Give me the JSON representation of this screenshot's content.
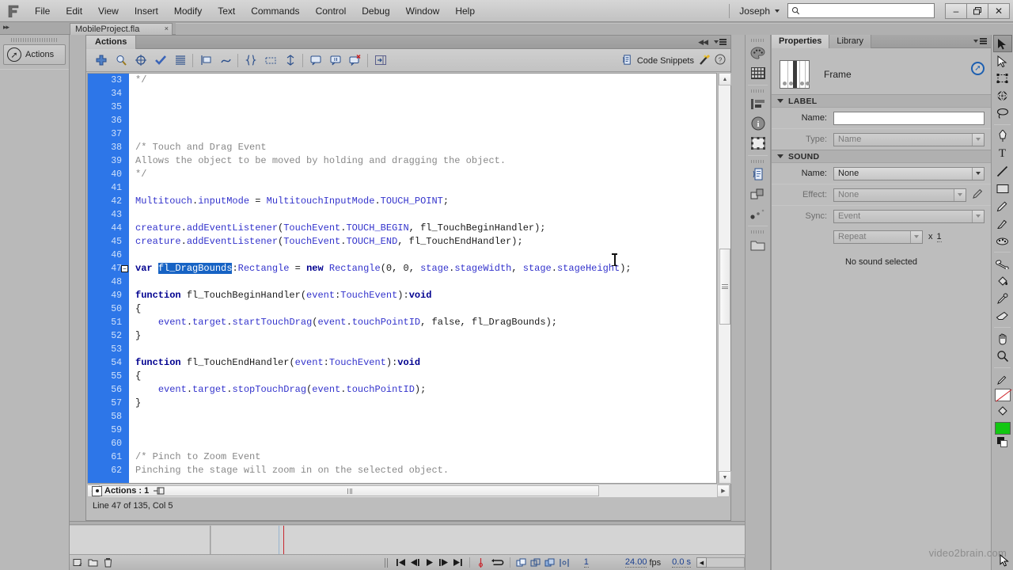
{
  "app": {
    "title": "Adobe Flash Professional",
    "logo": "fl-logo-icon"
  },
  "menubar": {
    "items": [
      "File",
      "Edit",
      "View",
      "Insert",
      "Modify",
      "Text",
      "Commands",
      "Control",
      "Debug",
      "Window",
      "Help"
    ],
    "user": "Joseph",
    "search": {
      "value": "",
      "placeholder": "",
      "icon": "search-icon"
    },
    "window_controls": {
      "minimize": "–",
      "restore": "❐",
      "close": "✕"
    }
  },
  "document_tab": {
    "label": "MobileProject.fla",
    "close": "×"
  },
  "left_dock": {
    "actions_chip_label": "Actions",
    "icon": "actions-arrow-icon"
  },
  "actions_panel": {
    "tab_label": "Actions",
    "titlebar": {
      "collapse": "◀◀",
      "menu": "panel-menu-icon"
    },
    "toolbar_icons": [
      "add-script-icon",
      "find-icon",
      "target-insert-icon",
      "check-syntax-icon",
      "auto-format-icon",
      "show-code-hint-icon",
      "debug-options-icon",
      "collapse-between-braces-icon",
      "collapse-selection-icon",
      "expand-all-icon",
      "apply-block-comment-icon",
      "apply-line-comment-icon",
      "remove-comment-icon",
      "show-hide-toolbox-icon"
    ],
    "code_snippets_label": "Code Snippets",
    "code_snippets_icon": "code-snippets-icon",
    "wand_icon": "magic-wand-icon",
    "help_icon": "help-icon",
    "breadcrumb": {
      "label": "Actions : 1",
      "pin_icon": "pin-script-icon"
    },
    "status": "Line 47 of 135, Col 5",
    "first_line_number": 33,
    "lines": [
      {
        "n": 33,
        "text": "*/",
        "style": "comment"
      },
      {
        "n": 34,
        "text": ""
      },
      {
        "n": 35,
        "text": ""
      },
      {
        "n": 36,
        "text": ""
      },
      {
        "n": 37,
        "text": ""
      },
      {
        "n": 38,
        "text": "/* Touch and Drag Event",
        "style": "comment"
      },
      {
        "n": 39,
        "text": "Allows the object to be moved by holding and dragging the object.",
        "style": "comment"
      },
      {
        "n": 40,
        "text": "*/",
        "style": "comment"
      },
      {
        "n": 41,
        "text": ""
      },
      {
        "n": 42,
        "text": "Multitouch.inputMode = MultitouchInputMode.TOUCH_POINT;",
        "style": "code"
      },
      {
        "n": 43,
        "text": ""
      },
      {
        "n": 44,
        "text": "creature.addEventListener(TouchEvent.TOUCH_BEGIN, fl_TouchBeginHandler);",
        "style": "code"
      },
      {
        "n": 45,
        "text": "creature.addEventListener(TouchEvent.TOUCH_END, fl_TouchEndHandler);",
        "style": "code"
      },
      {
        "n": 46,
        "text": ""
      },
      {
        "n": 47,
        "text": "var fl_DragBounds:Rectangle = new Rectangle(0, 0, stage.stageWidth, stage.stageHeight);",
        "style": "code",
        "fold": true,
        "selection": "fl_DragBounds"
      },
      {
        "n": 48,
        "text": ""
      },
      {
        "n": 49,
        "text": "function fl_TouchBeginHandler(event:TouchEvent):void",
        "style": "code"
      },
      {
        "n": 50,
        "text": "{",
        "style": "code"
      },
      {
        "n": 51,
        "text": "    event.target.startTouchDrag(event.touchPointID, false, fl_DragBounds);",
        "style": "code"
      },
      {
        "n": 52,
        "text": "}",
        "style": "code"
      },
      {
        "n": 53,
        "text": ""
      },
      {
        "n": 54,
        "text": "function fl_TouchEndHandler(event:TouchEvent):void",
        "style": "code"
      },
      {
        "n": 55,
        "text": "{",
        "style": "code"
      },
      {
        "n": 56,
        "text": "    event.target.stopTouchDrag(event.touchPointID);",
        "style": "code"
      },
      {
        "n": 57,
        "text": "}",
        "style": "code"
      },
      {
        "n": 58,
        "text": ""
      },
      {
        "n": 59,
        "text": ""
      },
      {
        "n": 60,
        "text": ""
      },
      {
        "n": 61,
        "text": "/* Pinch to Zoom Event",
        "style": "comment"
      },
      {
        "n": 62,
        "text": "Pinching the stage will zoom in on the selected object.",
        "style": "comment"
      }
    ]
  },
  "right_dock_icons": [
    "color-panel-icon",
    "swatches-panel-icon",
    "align-panel-icon",
    "info-panel-icon",
    "transform-panel-icon",
    "code-snippets-panel-icon",
    "components-panel-icon",
    "motion-presets-icon",
    "library-panel-icon"
  ],
  "properties": {
    "tabs": [
      {
        "label": "Properties",
        "active": true
      },
      {
        "label": "Library",
        "active": false
      }
    ],
    "menu_icon": "panel-menu-icon",
    "frame": {
      "label": "Frame",
      "thumb": "frame-thumbnail-icon",
      "badge": "edit-in-place-icon"
    },
    "sections": [
      {
        "title": "LABEL",
        "rows": [
          {
            "label": "Name:",
            "type": "input",
            "value": "",
            "disabled": false
          },
          {
            "label": "Type:",
            "type": "select",
            "value": "Name",
            "disabled": true
          }
        ]
      },
      {
        "title": "SOUND",
        "rows": [
          {
            "label": "Name:",
            "type": "select",
            "value": "None",
            "disabled": false
          },
          {
            "label": "Effect:",
            "type": "select",
            "value": "None",
            "disabled": true,
            "trailing_icon": "pencil-edit-icon"
          },
          {
            "label": "Sync:",
            "type": "select",
            "value": "Event",
            "disabled": true
          },
          {
            "label": "",
            "type": "select",
            "value": "Repeat",
            "disabled": true,
            "multiplier_label": "x",
            "multiplier_value": "1"
          }
        ],
        "footer": "No sound selected"
      }
    ]
  },
  "tools": {
    "items": [
      {
        "name": "selection-tool-icon",
        "glyph": "➤",
        "selected": true
      },
      {
        "name": "subselection-tool-icon",
        "glyph": "➤",
        "selected": false
      },
      {
        "name": "free-transform-tool-icon",
        "glyph": "❑",
        "selected": false
      },
      {
        "name": "3d-rotation-tool-icon",
        "glyph": "●",
        "selected": false
      },
      {
        "name": "lasso-tool-icon",
        "glyph": "◯",
        "selected": false
      },
      {
        "name": "pen-tool-icon",
        "glyph": "✒",
        "selected": false
      },
      {
        "name": "text-tool-icon",
        "glyph": "T",
        "selected": false
      },
      {
        "name": "line-tool-icon",
        "glyph": "╱",
        "selected": false
      },
      {
        "name": "rectangle-tool-icon",
        "glyph": "▭",
        "selected": false
      },
      {
        "name": "pencil-tool-icon",
        "glyph": "✎",
        "selected": false
      },
      {
        "name": "brush-tool-icon",
        "glyph": "✐",
        "selected": false
      },
      {
        "name": "deco-tool-icon",
        "glyph": "❁",
        "selected": false
      },
      {
        "name": "bone-tool-icon",
        "glyph": "☈",
        "selected": false
      },
      {
        "name": "paint-bucket-tool-icon",
        "glyph": "◢",
        "selected": false
      },
      {
        "name": "eyedropper-tool-icon",
        "glyph": "⚗",
        "selected": false
      },
      {
        "name": "eraser-tool-icon",
        "glyph": "▱",
        "selected": false
      },
      {
        "name": "hand-tool-icon",
        "glyph": "✋",
        "selected": false
      },
      {
        "name": "zoom-tool-icon",
        "glyph": "⚲",
        "selected": false
      }
    ],
    "stroke_color": "#ffffff",
    "stroke_none_slash": "#d0252b",
    "fill_color": "#13c713"
  },
  "timeline": {
    "layer_buttons": [
      "new-layer-icon",
      "new-folder-icon",
      "delete-layer-icon"
    ],
    "controls": [
      "go-to-first-frame-icon",
      "step-back-one-frame-icon",
      "play-icon",
      "step-forward-one-frame-icon",
      "go-to-last-frame-icon"
    ],
    "loop_icons": [
      "center-frame-icon",
      "loop-playback-icon"
    ],
    "onion_icons": [
      "onion-skin-icon",
      "onion-skin-outlines-icon",
      "edit-multiple-frames-icon",
      "modify-onion-markers-icon"
    ],
    "current_frame": "1",
    "fps_value": "24.00",
    "fps_label": "fps",
    "elapsed": "0.0 s",
    "zoom_handle_icon": "resize-timeline-icon"
  },
  "watermark": {
    "text": "video2brain",
    "suffix": ".com"
  },
  "colors": {
    "panel_bg": "#bdbdbd",
    "chrome_bg": "#b4b4b4",
    "gutter_selected": "#2d76e8",
    "code_bg": "#ffffff",
    "keyword": "#00008f",
    "class_name": "#3333cc",
    "comment": "#888888",
    "selection": "#1763c4",
    "accent_blue": "#1d5fb0"
  }
}
